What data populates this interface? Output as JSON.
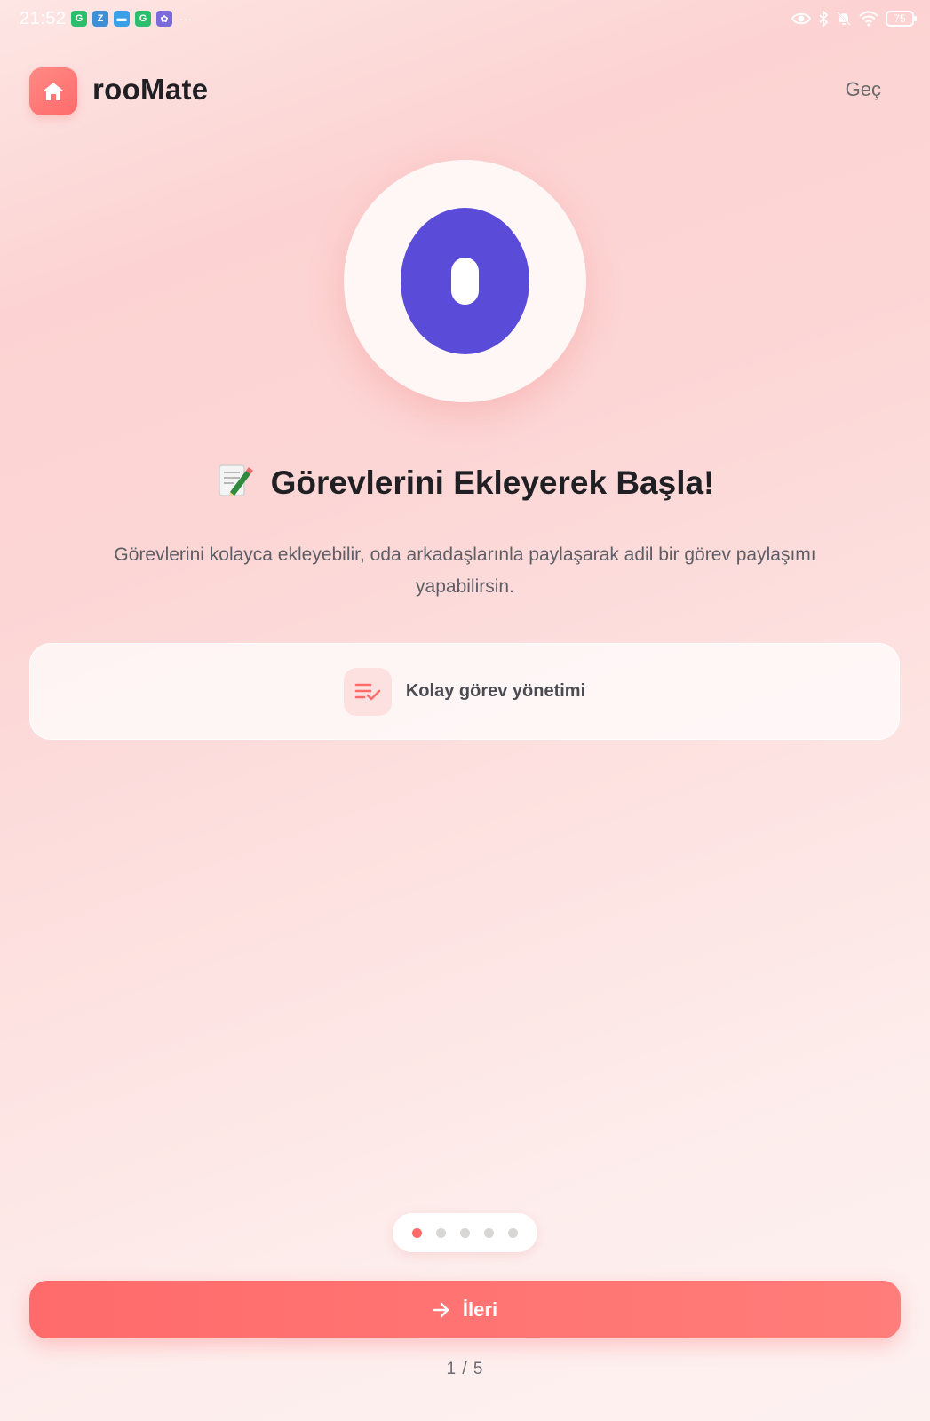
{
  "status_bar": {
    "time": "21:52",
    "more": "···",
    "battery": "75",
    "apps": [
      {
        "name": "grammarly",
        "color": "#2bbf6d",
        "glyph": "G"
      },
      {
        "name": "app-z",
        "color": "#3f8fd6",
        "glyph": "Z"
      },
      {
        "name": "messages",
        "color": "#3aa0e8",
        "glyph": "▬"
      },
      {
        "name": "grammarly-2",
        "color": "#2bbf6d",
        "glyph": "G"
      },
      {
        "name": "gallery",
        "color": "#7b6ad9",
        "glyph": "✿"
      }
    ]
  },
  "header": {
    "app_name": "rooMate",
    "skip_label": "Geç"
  },
  "hero": {
    "emoji_color": "#5a4cd8"
  },
  "content": {
    "title": "Görevlerini Ekleyerek Başla!",
    "description": "Görevlerini kolayca ekleyebilir, oda arkadaşlarınla paylaşarak adil bir görev paylaşımı yapabilirsin.",
    "feature_label": "Kolay görev yönetimi"
  },
  "pager": {
    "current": 1,
    "total": 5
  },
  "footer": {
    "next_label": "İleri",
    "page_counter": "1 / 5"
  },
  "colors": {
    "accent": "#ff6b6b",
    "text_primary": "#1f1f24",
    "text_secondary": "#5e5e66"
  }
}
